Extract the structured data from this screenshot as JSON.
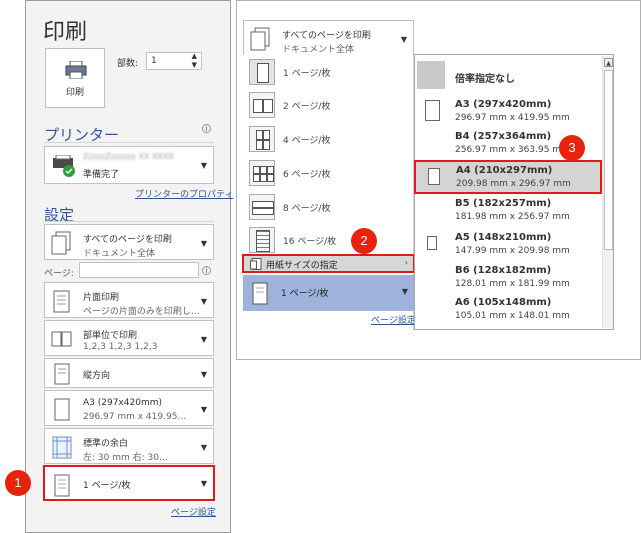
{
  "left": {
    "title": "印刷",
    "print_button_label": "印刷",
    "copies_label": "部数:",
    "copies_value": "1",
    "printer_heading": "プリンター",
    "printer_name": "ZzzzzZzzzzzz XX XXXX",
    "printer_status": "準備完了",
    "printer_props_link": "プリンターのプロパティ",
    "settings_heading": "設定",
    "print_what": {
      "line1": "すべてのページを印刷",
      "line2": "ドキュメント全体"
    },
    "pages_label": "ページ:",
    "pages_value": "",
    "duplex": {
      "line1": "片面印刷",
      "line2": "ページの片面のみを印刷し…"
    },
    "collate": {
      "line1": "部単位で印刷",
      "line2": "1,2,3    1,2,3    1,2,3"
    },
    "orientation": {
      "line1": "縦方向"
    },
    "paper": {
      "line1": "A3 (297x420mm)",
      "line2": "296.97 mm x 419.95…"
    },
    "margins": {
      "line1": "標準の余白",
      "line2": "左: 30 mm   右: 30…"
    },
    "pages_per_sheet": {
      "line1": "1 ページ/枚"
    },
    "page_setup_link": "ページ設定",
    "badge1": "1"
  },
  "right": {
    "print_what": {
      "line1": "すべてのページを印刷",
      "line2": "ドキュメント全体"
    },
    "pps_items": [
      "1 ページ/枚",
      "2 ページ/枚",
      "4 ページ/枚",
      "6 ページ/枚",
      "8 ページ/枚",
      "16 ページ/枚"
    ],
    "scale_item": "用紙サイズの指定",
    "selected_pps": "1 ページ/枚",
    "page_setup_link": "ページ設定",
    "badge2": "2",
    "badge3": "3",
    "submenu_first": "倍率指定なし",
    "sizes": [
      {
        "title": "A3 (297x420mm)",
        "sub": "296.97 mm x 419.95 mm"
      },
      {
        "title": "B4 (257x364mm)",
        "sub": "256.97 mm x 363.95 mm"
      },
      {
        "title": "A4 (210x297mm)",
        "sub": "209.98 mm x 296.97 mm"
      },
      {
        "title": "B5 (182x257mm)",
        "sub": "181.98 mm x 256.97 mm"
      },
      {
        "title": "A5 (148x210mm)",
        "sub": "147.99 mm x 209.98 mm"
      },
      {
        "title": "B6 (128x182mm)",
        "sub": "128.01 mm x 181.99 mm"
      },
      {
        "title": "A6 (105x148mm)",
        "sub": "105.01 mm x 148.01 mm"
      }
    ]
  },
  "colors": {
    "accent": "#2f5597",
    "highlight": "#d7d7d7",
    "selected_bg": "#9db3db",
    "red": "#e0191d",
    "badge": "#e8220d"
  }
}
